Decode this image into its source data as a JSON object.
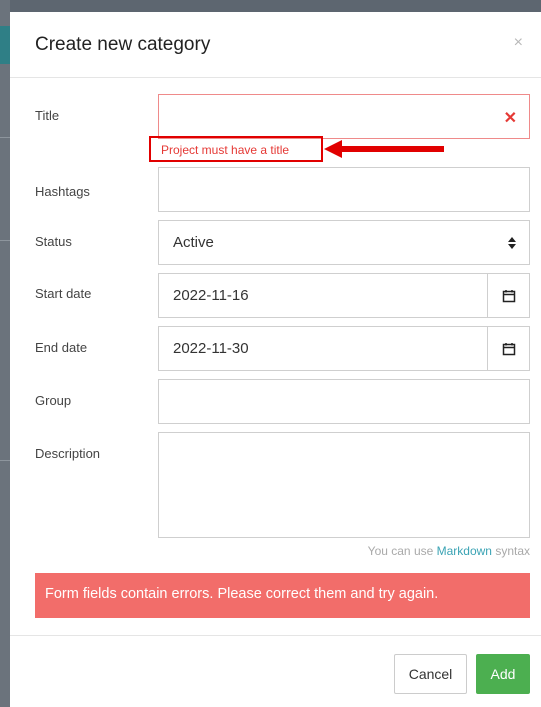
{
  "modal": {
    "title": "Create new category",
    "close_glyph": "×"
  },
  "form": {
    "title": {
      "label": "Title",
      "value": "",
      "error": "Project must have a title",
      "error_glyph": "✕"
    },
    "hashtags": {
      "label": "Hashtags",
      "value": ""
    },
    "status": {
      "label": "Status",
      "value": "Active"
    },
    "start_date": {
      "label": "Start date",
      "value": "2022-11-16",
      "icon": "calendar-icon"
    },
    "end_date": {
      "label": "End date",
      "value": "2022-11-30",
      "icon": "calendar-icon"
    },
    "group": {
      "label": "Group",
      "value": ""
    },
    "description": {
      "label": "Description",
      "value": ""
    }
  },
  "hint": {
    "prefix": "You can use ",
    "link": "Markdown",
    "suffix": " syntax"
  },
  "alert": {
    "message": "Form fields contain errors. Please correct them and try again."
  },
  "buttons": {
    "cancel": "Cancel",
    "add": "Add"
  },
  "colors": {
    "error": "#e53935",
    "alert_bg": "#f26d6a",
    "primary": "#4caf50",
    "link": "#3aa3b4",
    "annotation": "#e10000"
  }
}
